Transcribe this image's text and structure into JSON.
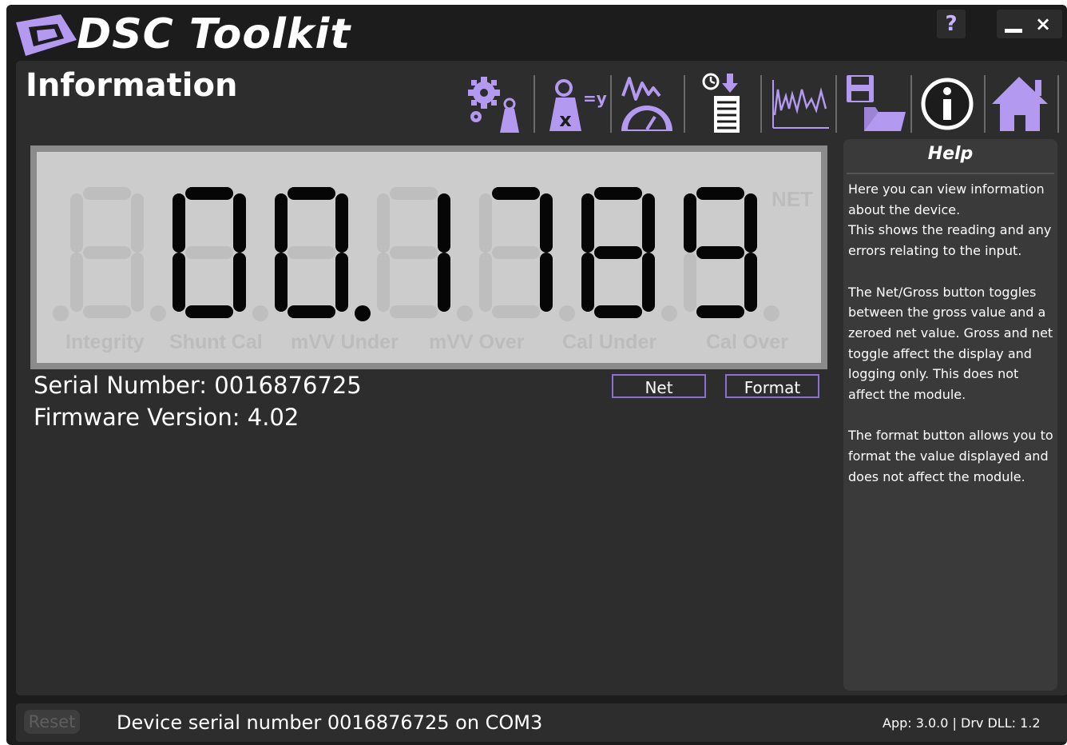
{
  "app": {
    "title": "DSC Toolkit",
    "window_controls": {
      "help": "?",
      "close": "×"
    }
  },
  "section": {
    "title": "Information"
  },
  "toolbar": {
    "items": [
      {
        "id": "settings",
        "icon": "gear-weight-icon"
      },
      {
        "id": "calibration",
        "icon": "weight-xy-icon"
      },
      {
        "id": "gauge",
        "icon": "signal-gauge-icon"
      },
      {
        "id": "timed-log",
        "icon": "timer-log-icon"
      },
      {
        "id": "chart",
        "icon": "waveform-icon"
      },
      {
        "id": "save-open",
        "icon": "save-folder-icon"
      },
      {
        "id": "information",
        "icon": "info-icon",
        "active": true
      },
      {
        "id": "home",
        "icon": "home-icon"
      }
    ],
    "accent_color": "#b399f0"
  },
  "display": {
    "reading": "00.1789",
    "net_indicator": "NET",
    "errors": [
      "Integrity",
      "Shunt Cal",
      "mVV Under",
      "mVV Over",
      "Cal Under",
      "Cal Over"
    ]
  },
  "info": {
    "serial_line": "Serial Number:  0016876725",
    "firmware_line": "Firmware Version: 4.02"
  },
  "buttons": {
    "net": "Net",
    "format": "Format"
  },
  "help": {
    "title": "Help",
    "paragraphs": [
      "Here you can view information about the device.\nThis shows the reading and any errors relating to the input.",
      "The Net/Gross button toggles between the gross value and a zeroed net value. Gross and net toggle affect the display and logging only. This does not affect the module.",
      "The format button allows you to format the value displayed and does not affect the module."
    ]
  },
  "status": {
    "reset_label": "Reset",
    "message": "Device serial number 0016876725 on COM3",
    "version": "App: 3.0.0 | Drv DLL: 1.2"
  }
}
